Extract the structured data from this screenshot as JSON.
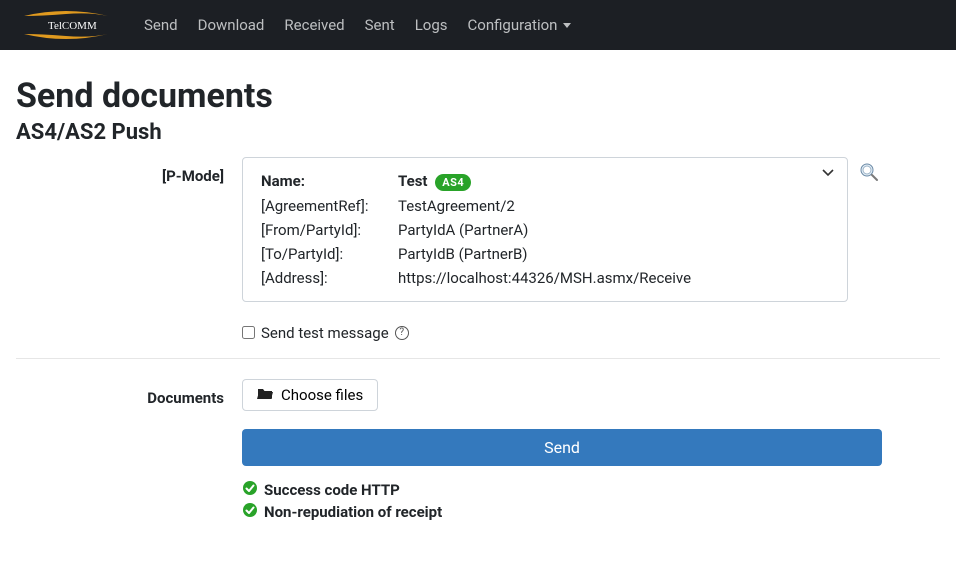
{
  "nav": {
    "items": [
      "Send",
      "Download",
      "Received",
      "Sent",
      "Logs",
      "Configuration"
    ]
  },
  "page": {
    "title": "Send documents",
    "subtitle": "AS4/AS2 Push"
  },
  "pmode": {
    "label": "[P-Mode]",
    "name_key": "Name:",
    "name_val": "Test",
    "badge": "AS4",
    "rows": [
      {
        "k": "[AgreementRef]:",
        "v": "TestAgreement/2"
      },
      {
        "k": "[From/PartyId]:",
        "v": "PartyIdA (PartnerA)"
      },
      {
        "k": "[To/PartyId]:",
        "v": "PartyIdB (PartnerB)"
      },
      {
        "k": "[Address]:",
        "v": "https://localhost:44326/MSH.asmx/Receive"
      }
    ],
    "send_test_label": "Send test message"
  },
  "documents": {
    "label": "Documents",
    "choose_label": "Choose files",
    "send_label": "Send"
  },
  "status": {
    "items": [
      "Success code HTTP",
      "Non-repudiation of receipt"
    ]
  }
}
